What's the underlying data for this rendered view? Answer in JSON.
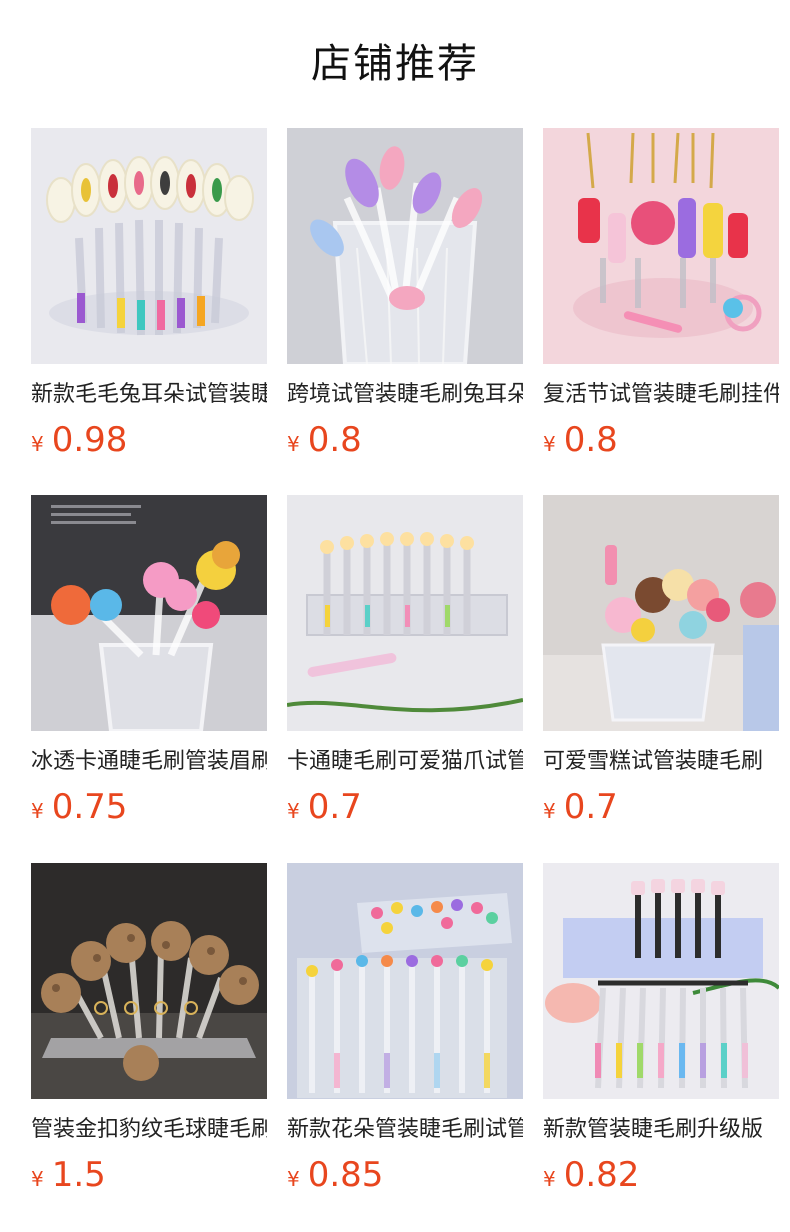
{
  "section_title": "店铺推荐",
  "currency_symbol": "¥",
  "accent_color": "#e8461e",
  "products": [
    {
      "name": "新款毛毛兔耳朵试管装睫毛刷",
      "price": "0.98",
      "image": "bunny-ear-tube-brushes-photo"
    },
    {
      "name": "跨境试管装睫毛刷兔耳朵",
      "price": "0.8",
      "image": "bunny-tube-brushes-in-glass-photo"
    },
    {
      "name": "复活节试管装睫毛刷挂件",
      "price": "0.8",
      "image": "easter-keychain-brushes-photo"
    },
    {
      "name": "冰透卡通睫毛刷管装眉刷",
      "price": "0.75",
      "image": "cartoon-figure-brushes-photo"
    },
    {
      "name": "卡通睫毛刷可爱猫爪试管",
      "price": "0.7",
      "image": "cat-paw-tube-rack-photo"
    },
    {
      "name": "可爱雪糕试管装睫毛刷",
      "price": "0.7",
      "image": "ice-cream-brushes-photo"
    },
    {
      "name": "管装金扣豹纹毛球睫毛刷",
      "price": "1.5",
      "image": "leopard-pompom-brushes-photo"
    },
    {
      "name": "新款花朵管装睫毛刷试管",
      "price": "0.85",
      "image": "flower-tube-brushes-photo"
    },
    {
      "name": "新款管装睫毛刷升级版",
      "price": "0.82",
      "image": "clear-tube-brushes-rack-photo"
    }
  ]
}
